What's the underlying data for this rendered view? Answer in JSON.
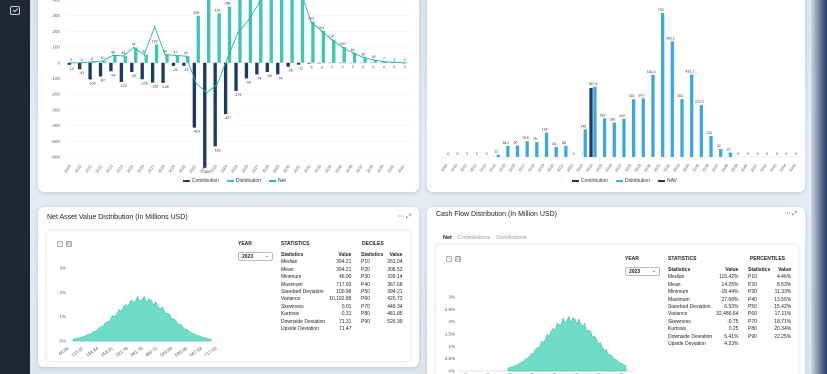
{
  "sidebar": {
    "icon": "check-square-icon"
  },
  "chart1": {
    "legend": [
      "Contribution",
      "Distribution",
      "Net"
    ],
    "colors": {
      "contribution": "#1b3a66",
      "distribution": "#3cc6b3",
      "net": "#2bb8a6"
    }
  },
  "chart2": {
    "legend": [
      "Contribution",
      "Distribution",
      "NAV"
    ],
    "colors": {
      "contribution": "#1b3a66",
      "distribution": "#3ea7e0",
      "nav": "#1e3560"
    }
  },
  "nav_panel": {
    "title": "Net Asset Value Distribution (In Millions USD)",
    "year_label": "YEAR",
    "year_value": "2023",
    "stats_header": "STATISTICS",
    "deciles_header": "DECILES",
    "col_statistics": "Statistics",
    "col_value": "Value",
    "stats": [
      [
        "Median",
        "394.21"
      ],
      [
        "Mean",
        "394.21"
      ],
      [
        "Minimum",
        "46.90"
      ],
      [
        "Maximum",
        "717.60"
      ],
      [
        "Standard Deviation",
        "100.96"
      ],
      [
        "Variance",
        "10,192.89"
      ],
      [
        "Skewness",
        "0.01"
      ],
      [
        "Kurtosis",
        "-0.31"
      ],
      [
        "Downside Deviation",
        "71.31"
      ],
      [
        "Upside Deviation",
        "71.47"
      ]
    ],
    "deciles": [
      [
        "P10",
        "263.04"
      ],
      [
        "P20",
        "306.52"
      ],
      [
        "P30",
        "339.14"
      ],
      [
        "P40",
        "367.68"
      ],
      [
        "P50",
        "394.21"
      ],
      [
        "P60",
        "420.72"
      ],
      [
        "P70",
        "449.34"
      ],
      [
        "P80",
        "481.85"
      ],
      [
        "P90",
        "526.39"
      ]
    ]
  },
  "cf_panel": {
    "title": "Cash Flow Distribution (In Million USD)",
    "tabs": [
      "Net",
      "Contributions",
      "Distributions"
    ],
    "year_label": "YEAR",
    "year_value": "2023",
    "stats_header": "STATISTICS",
    "pct_header": "PERCENTILES",
    "col_statistics": "Statistics",
    "col_value": "Value",
    "stats": [
      [
        "Median",
        "115.42%"
      ],
      [
        "Mean",
        "14.25%"
      ],
      [
        "Minimum",
        "-18.44%"
      ],
      [
        "Maximum",
        "27.68%"
      ],
      [
        "Standard Deviation",
        "6.93%"
      ],
      [
        "Variance",
        "32,486.64"
      ],
      [
        "Skewness",
        "-0.75"
      ],
      [
        "Kurtosis",
        "0.25"
      ],
      [
        "Downside Deviation",
        "5.41%"
      ],
      [
        "Upside Deviation",
        "4.33%"
      ]
    ],
    "pcts": [
      [
        "P10",
        "4.46%"
      ],
      [
        "P20",
        "8.53%"
      ],
      [
        "P30",
        "11.33%"
      ],
      [
        "P40",
        "13.55%"
      ],
      [
        "P50",
        "15.42%"
      ],
      [
        "P60",
        "17.11%"
      ],
      [
        "P70",
        "18.71%"
      ],
      [
        "P80",
        "20.34%"
      ],
      [
        "P90",
        "22.25%"
      ]
    ]
  },
  "chart_data": [
    {
      "type": "bar",
      "title": "",
      "ylim": [
        -600,
        400
      ],
      "yticks": [
        "400",
        "300",
        "200",
        "100",
        "0",
        "-100",
        "-200",
        "-300",
        "-400",
        "-500",
        "-600"
      ],
      "categories": [
        "2009",
        "2010",
        "2011",
        "2012",
        "2013",
        "2014",
        "2015",
        "2016",
        "2017",
        "2018",
        "2019",
        "2020",
        "2021",
        "2022",
        "2023",
        "2024",
        "2025",
        "2026",
        "2027",
        "2028",
        "2029",
        "2030",
        "2031",
        "2032",
        "2033",
        "2034",
        "2035",
        "2036",
        "2037",
        "2038",
        "2039",
        "2040",
        "2041"
      ],
      "series": [
        {
          "name": "Contribution",
          "values": [
            -13,
            -41,
            -106,
            -87,
            -54,
            -122,
            -59,
            -105,
            -126,
            -128,
            -20,
            -19,
            -413,
            -669,
            -532,
            -327,
            -179,
            -99,
            -74,
            -59,
            -74,
            -25,
            -12,
            -5,
            -3,
            -1,
            -1,
            0,
            0,
            0,
            0,
            0,
            0
          ]
        },
        {
          "name": "Distribution",
          "values": [
            0,
            0,
            6,
            10,
            48,
            44,
            97,
            52,
            117,
            54,
            47,
            42,
            299,
            678,
            315,
            358,
            403,
            547,
            677,
            766,
            1266,
            615,
            462,
            262,
            204,
            147,
            100,
            64,
            35,
            18,
            7,
            3,
            0
          ]
        },
        {
          "name": "Net",
          "values": [
            0,
            0,
            6,
            10,
            48,
            44,
            97,
            52,
            229,
            54,
            47,
            42,
            -132,
            -191,
            -137,
            31,
            193,
            270,
            377,
            709,
            1266,
            615,
            462,
            262,
            204,
            147,
            100,
            64,
            35,
            18,
            7,
            3,
            0
          ]
        }
      ],
      "labels_top": [
        "0",
        "0",
        "6",
        "10",
        "48",
        "44",
        "97",
        "52",
        "229",
        "54",
        "47",
        "42",
        "299",
        "678",
        "315",
        "358",
        "403",
        "547",
        "677",
        "766",
        "1,266",
        "615",
        "462",
        "262",
        "204",
        "147",
        "100",
        "64",
        "35",
        "18",
        "7",
        "3",
        "0"
      ],
      "labels_bottom": [
        "-13",
        "-41",
        "-106",
        "-87",
        "-54",
        "-122",
        "-59",
        "-105",
        "-126",
        "-128",
        "-20",
        "-19",
        "-413",
        "-669",
        "-532",
        "-327",
        "-179",
        "-99",
        "-74",
        "-59",
        "-74",
        "-25",
        "-12",
        "-5",
        "-3",
        "-1",
        "-1",
        "0",
        "0",
        "0",
        "0",
        "0",
        "0"
      ]
    },
    {
      "type": "bar",
      "title": "",
      "ylim": [
        0,
        800
      ],
      "categories": [
        "2009",
        "2010",
        "2011",
        "2012",
        "2013",
        "2014",
        "2015",
        "2016",
        "2017",
        "2018",
        "2019",
        "2020",
        "2021",
        "2022",
        "2023",
        "2024",
        "2025",
        "2026",
        "2027",
        "2028",
        "2029",
        "2030",
        "2031",
        "2032",
        "2033",
        "2034",
        "2035",
        "2036",
        "2037",
        "2038",
        "2039",
        "2040",
        "2041",
        "2042",
        "2043",
        "2044",
        "2045"
      ],
      "series": [
        {
          "name": "Contribution",
          "values": [
            0,
            0,
            0,
            0,
            0,
            0,
            0,
            0,
            0,
            0,
            0,
            0,
            0,
            0,
            0,
            361,
            0,
            0,
            0,
            0,
            0,
            0,
            0,
            0,
            0,
            0,
            0,
            0,
            0,
            0,
            0,
            0,
            0,
            0,
            0,
            0,
            0
          ]
        },
        {
          "name": "Distribution",
          "values": [
            0,
            0,
            0,
            0,
            0,
            12,
            58,
            60,
            83,
            78,
            128,
            53,
            58,
            0,
            145,
            367,
            202,
            180,
            200,
            302,
            307,
            430,
            753,
            605,
            303,
            432,
            272,
            110,
            42,
            23,
            0,
            0,
            0,
            0,
            0,
            0,
            0
          ]
        },
        {
          "name": "NAV",
          "values": [
            0,
            0,
            0,
            0,
            0,
            0,
            0,
            0,
            0,
            0,
            0,
            0,
            0,
            0,
            0,
            0,
            0,
            0,
            0,
            0,
            0,
            0,
            0,
            0,
            0,
            0,
            0,
            0,
            0,
            0,
            0,
            0,
            0,
            0,
            0,
            0,
            0
          ]
        }
      ],
      "labels": [
        "0",
        "0",
        "0",
        "0",
        "0",
        "12",
        "58.2",
        "60",
        "78.5",
        "78",
        "128",
        "53",
        "58",
        "0",
        "145",
        "367.6",
        "202",
        "180",
        "200",
        "302",
        "307",
        "430.3",
        "733",
        "605.2",
        "303",
        "432.1",
        "272.2",
        "110",
        "42",
        "23",
        "0",
        "0",
        "0",
        "0",
        "0",
        "0",
        "0"
      ]
    },
    {
      "type": "area",
      "title": "",
      "yticks": [
        "3%",
        "2%",
        "1%",
        "0%"
      ],
      "xticks": [
        "46.90",
        "115.87",
        "184.84",
        "253.81",
        "322.78",
        "391.75",
        "460.72",
        "529.69",
        "598.66",
        "667.63",
        "717.60"
      ]
    },
    {
      "type": "area",
      "title": "",
      "yticks": [
        "3%",
        "2.5%",
        "2%",
        "1.5%",
        "1%",
        "0.5%",
        "0%"
      ]
    }
  ]
}
